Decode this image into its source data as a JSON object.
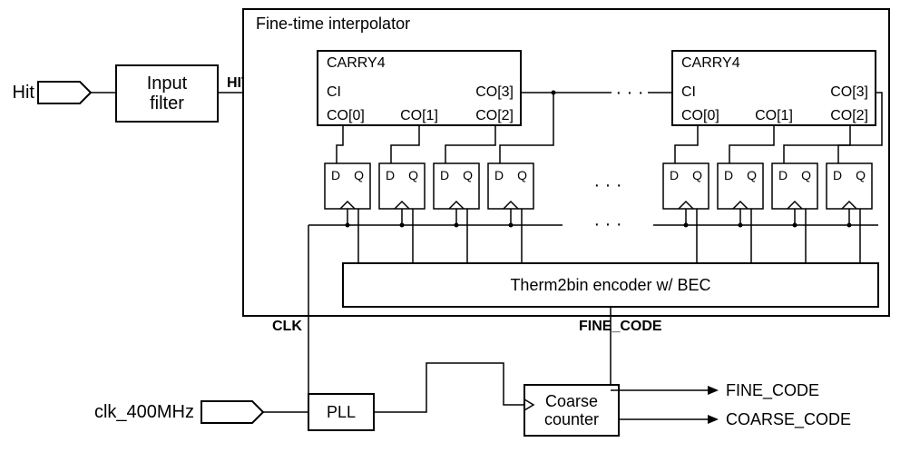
{
  "inputs": {
    "hit_label": "Hit",
    "clk_label": "clk_400MHz"
  },
  "blocks": {
    "input_filter_l1": "Input",
    "input_filter_l2": "filter",
    "pll": "PLL",
    "coarse_l1": "Coarse",
    "coarse_l2": "counter",
    "encoder": "Therm2bin  encoder w/ BEC",
    "fti_title": "Fine-time interpolator"
  },
  "carry4": {
    "title": "CARRY4",
    "ci": "CI",
    "co0": "CO[0]",
    "co1": "CO[1]",
    "co2": "CO[2]",
    "co3": "CO[3]"
  },
  "ff": {
    "d": "D",
    "q": "Q"
  },
  "signals": {
    "hit": "HIT",
    "clk": "CLK",
    "fine_code_bus": "FINE_CODE",
    "fine_code_out": "FINE_CODE",
    "coarse_code_out": "COARSE_CODE"
  },
  "dots": "· · ·"
}
